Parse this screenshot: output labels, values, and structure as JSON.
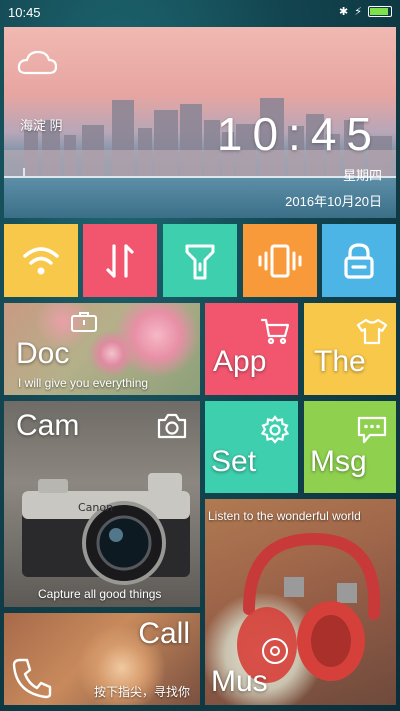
{
  "status_bar": {
    "time": "10:45",
    "bt_glyph": "✱",
    "charge_glyph": "⚡"
  },
  "weather": {
    "location_condition": "海淀 阴",
    "clock": "10:45",
    "weekday": "星期四",
    "date": "2016年10月20日"
  },
  "toggles": [
    {
      "name": "wifi-toggle",
      "icon": "wifi-icon",
      "color": "#f8c84a"
    },
    {
      "name": "mobile-data-toggle",
      "icon": "data-arrows-icon",
      "color": "#f2566f"
    },
    {
      "name": "flashlight-toggle",
      "icon": "flashlight-icon",
      "color": "#3ecfae"
    },
    {
      "name": "vibrate-toggle",
      "icon": "vibrate-icon",
      "color": "#f99a3a"
    },
    {
      "name": "lock-toggle",
      "icon": "lock-icon",
      "color": "#4cb5e6"
    }
  ],
  "tiles": {
    "doc": {
      "label": "Doc",
      "sub": "I will give you everything"
    },
    "app": {
      "label": "App",
      "color": "#f2566f"
    },
    "theme": {
      "label": "The",
      "color": "#f8c84a"
    },
    "cam": {
      "label": "Cam",
      "sub": "Capture all good things"
    },
    "settings": {
      "label": "Set",
      "color": "#3ecfae"
    },
    "msg": {
      "label": "Msg",
      "color": "#8fd14f"
    },
    "music": {
      "label": "Mus",
      "sub": "Listen to the wonderful world"
    },
    "call": {
      "label": "Call",
      "sub": "按下指尖，寻找你"
    }
  }
}
